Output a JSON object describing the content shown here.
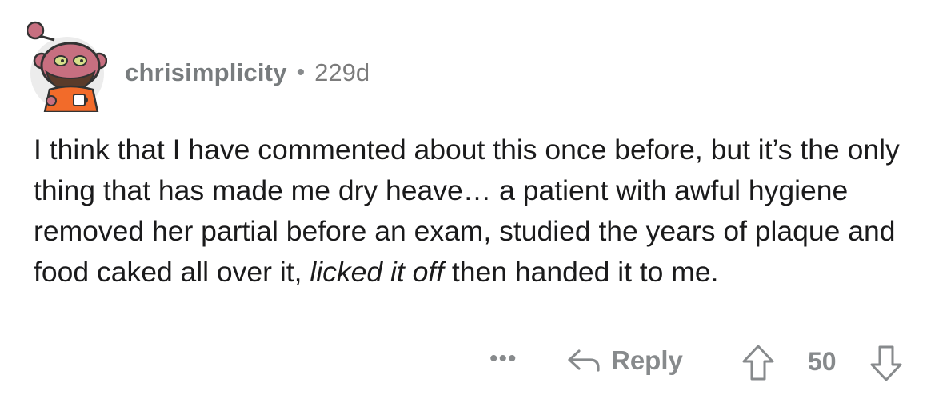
{
  "comment": {
    "username": "chrisimplicity",
    "separator": "•",
    "age": "229d",
    "body_before_em": "I think that I have commented about this once before, but it’s the only thing that has made me dry heave… a patient with awful hygiene removed her partial before an exam, studied the years of plaque and food caked all over it, ",
    "body_em": "licked it off",
    "body_after_em": " then handed it to me."
  },
  "actions": {
    "more_label": "•••",
    "reply_label": "Reply",
    "score": "50"
  },
  "colors": {
    "text": "#1a1a1b",
    "muted": "#878a8c",
    "avatar_skin": "#c76f80",
    "avatar_shirt": "#f26b2a",
    "avatar_bg": "#e9e9e9"
  },
  "icons": {
    "avatar": "snoo-avatar-icon",
    "reply": "reply-arrow-icon",
    "upvote": "upvote-arrow-icon",
    "downvote": "downvote-arrow-icon"
  }
}
